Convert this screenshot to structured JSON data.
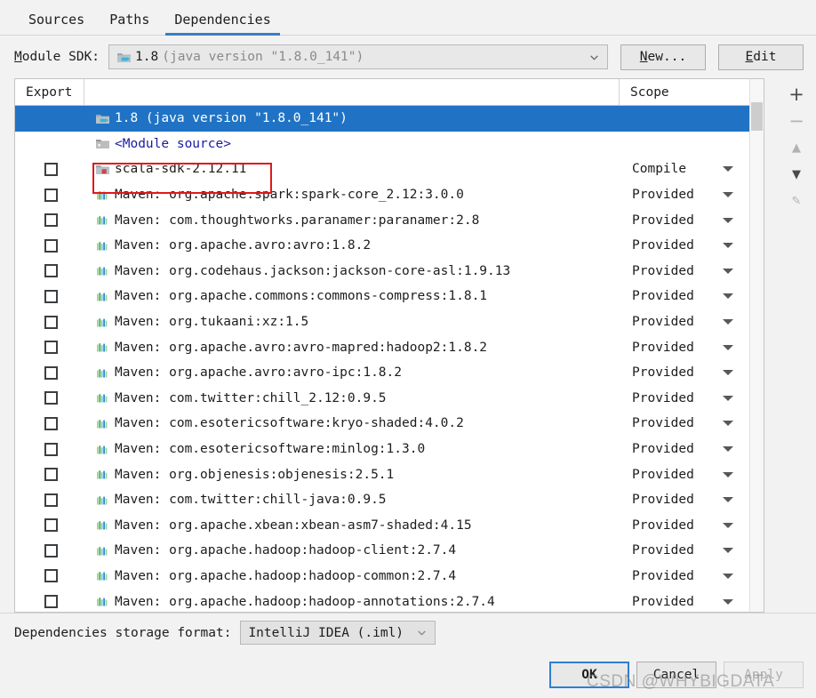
{
  "tabs": [
    {
      "label": "Sources",
      "active": false
    },
    {
      "label": "Paths",
      "active": false
    },
    {
      "label": "Dependencies",
      "active": true
    }
  ],
  "sdk_row": {
    "label_pre": "M",
    "label_rest": "odule SDK:",
    "value_strong": "1.8",
    "value_dim": "(java version \"1.8.0_141\")",
    "icon": "java-sdk-folder-icon",
    "new_button": {
      "accel": "N",
      "rest": "ew..."
    },
    "edit_button": {
      "accel": "E",
      "rest": "dit"
    }
  },
  "table": {
    "columns": [
      "Export",
      "",
      "Scope"
    ],
    "rows": [
      {
        "checkbox": false,
        "show_checkbox": false,
        "selected": true,
        "icon": "java-sdk-folder-icon",
        "name": "1.8 (java version \"1.8.0_141\")",
        "link": false,
        "scope": ""
      },
      {
        "checkbox": false,
        "show_checkbox": false,
        "selected": false,
        "icon": "module-source-icon",
        "name": "<Module source>",
        "link": true,
        "scope": ""
      },
      {
        "checkbox": false,
        "show_checkbox": true,
        "selected": false,
        "icon": "scala-sdk-folder-icon",
        "name": "scala-sdk-2.12.11",
        "link": false,
        "scope": "Compile"
      },
      {
        "checkbox": false,
        "show_checkbox": true,
        "selected": false,
        "icon": "maven-library-icon",
        "name": "Maven: org.apache.spark:spark-core_2.12:3.0.0",
        "link": false,
        "scope": "Provided"
      },
      {
        "checkbox": false,
        "show_checkbox": true,
        "selected": false,
        "icon": "maven-library-icon",
        "name": "Maven: com.thoughtworks.paranamer:paranamer:2.8",
        "link": false,
        "scope": "Provided"
      },
      {
        "checkbox": false,
        "show_checkbox": true,
        "selected": false,
        "icon": "maven-library-icon",
        "name": "Maven: org.apache.avro:avro:1.8.2",
        "link": false,
        "scope": "Provided"
      },
      {
        "checkbox": false,
        "show_checkbox": true,
        "selected": false,
        "icon": "maven-library-icon",
        "name": "Maven: org.codehaus.jackson:jackson-core-asl:1.9.13",
        "link": false,
        "scope": "Provided"
      },
      {
        "checkbox": false,
        "show_checkbox": true,
        "selected": false,
        "icon": "maven-library-icon",
        "name": "Maven: org.apache.commons:commons-compress:1.8.1",
        "link": false,
        "scope": "Provided"
      },
      {
        "checkbox": false,
        "show_checkbox": true,
        "selected": false,
        "icon": "maven-library-icon",
        "name": "Maven: org.tukaani:xz:1.5",
        "link": false,
        "scope": "Provided"
      },
      {
        "checkbox": false,
        "show_checkbox": true,
        "selected": false,
        "icon": "maven-library-icon",
        "name": "Maven: org.apache.avro:avro-mapred:hadoop2:1.8.2",
        "link": false,
        "scope": "Provided"
      },
      {
        "checkbox": false,
        "show_checkbox": true,
        "selected": false,
        "icon": "maven-library-icon",
        "name": "Maven: org.apache.avro:avro-ipc:1.8.2",
        "link": false,
        "scope": "Provided"
      },
      {
        "checkbox": false,
        "show_checkbox": true,
        "selected": false,
        "icon": "maven-library-icon",
        "name": "Maven: com.twitter:chill_2.12:0.9.5",
        "link": false,
        "scope": "Provided"
      },
      {
        "checkbox": false,
        "show_checkbox": true,
        "selected": false,
        "icon": "maven-library-icon",
        "name": "Maven: com.esotericsoftware:kryo-shaded:4.0.2",
        "link": false,
        "scope": "Provided"
      },
      {
        "checkbox": false,
        "show_checkbox": true,
        "selected": false,
        "icon": "maven-library-icon",
        "name": "Maven: com.esotericsoftware:minlog:1.3.0",
        "link": false,
        "scope": "Provided"
      },
      {
        "checkbox": false,
        "show_checkbox": true,
        "selected": false,
        "icon": "maven-library-icon",
        "name": "Maven: org.objenesis:objenesis:2.5.1",
        "link": false,
        "scope": "Provided"
      },
      {
        "checkbox": false,
        "show_checkbox": true,
        "selected": false,
        "icon": "maven-library-icon",
        "name": "Maven: com.twitter:chill-java:0.9.5",
        "link": false,
        "scope": "Provided"
      },
      {
        "checkbox": false,
        "show_checkbox": true,
        "selected": false,
        "icon": "maven-library-icon",
        "name": "Maven: org.apache.xbean:xbean-asm7-shaded:4.15",
        "link": false,
        "scope": "Provided"
      },
      {
        "checkbox": false,
        "show_checkbox": true,
        "selected": false,
        "icon": "maven-library-icon",
        "name": "Maven: org.apache.hadoop:hadoop-client:2.7.4",
        "link": false,
        "scope": "Provided"
      },
      {
        "checkbox": false,
        "show_checkbox": true,
        "selected": false,
        "icon": "maven-library-icon",
        "name": "Maven: org.apache.hadoop:hadoop-common:2.7.4",
        "link": false,
        "scope": "Provided"
      },
      {
        "checkbox": false,
        "show_checkbox": true,
        "selected": false,
        "icon": "maven-library-icon",
        "name": "Maven: org.apache.hadoop:hadoop-annotations:2.7.4",
        "link": false,
        "scope": "Provided"
      }
    ]
  },
  "right_toolbar": [
    {
      "name": "add-button",
      "glyph": "+",
      "enabled": true
    },
    {
      "name": "remove-button",
      "glyph": "−",
      "enabled": false
    },
    {
      "name": "move-up-button",
      "glyph": "▲",
      "enabled": false
    },
    {
      "name": "move-down-button",
      "glyph": "▼",
      "enabled": true
    },
    {
      "name": "edit-button",
      "glyph": "✎",
      "enabled": false
    }
  ],
  "storage": {
    "label": "Dependencies storage format:",
    "value": "IntelliJ IDEA (.iml)"
  },
  "footer": {
    "ok": "OK",
    "cancel": "Cancel",
    "apply": "Apply"
  },
  "watermark": "CSDN @WHYBIGDATA",
  "colors": {
    "selection_blue": "#2073c4",
    "tab_underline": "#3b7cc4",
    "annotation_red": "#e11919",
    "link_blue": "#1a1aa6"
  }
}
